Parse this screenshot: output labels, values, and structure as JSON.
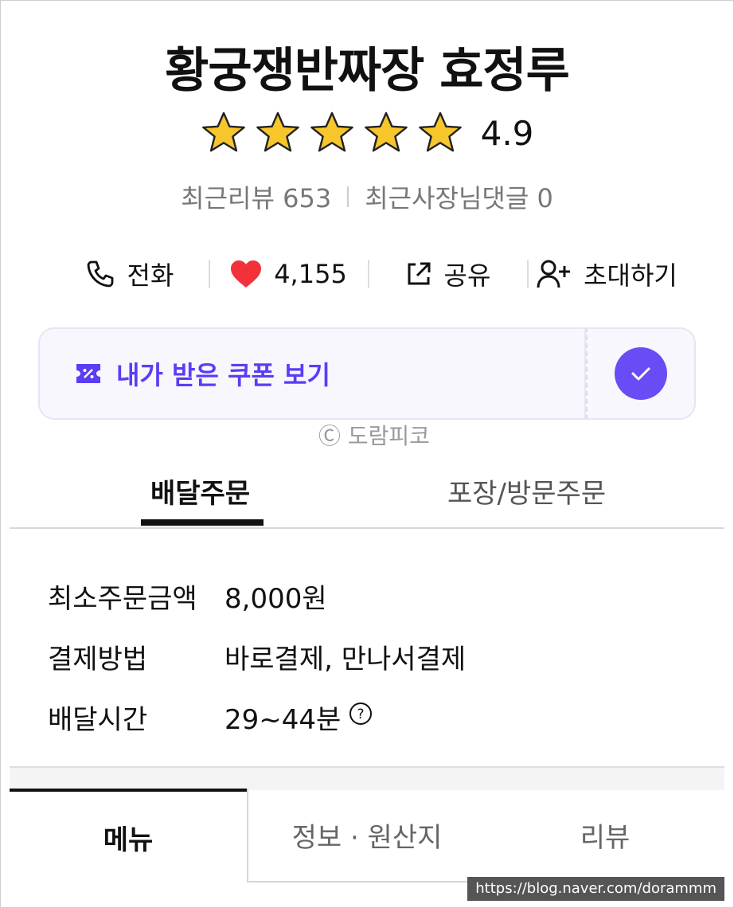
{
  "store": {
    "name": "황궁쟁반짜장 효정루",
    "rating": "4.9",
    "rating_stars": 5,
    "recent_reviews": "최근리뷰 653",
    "owner_replies": "최근사장님댓글 0"
  },
  "actions": {
    "call": "전화",
    "likes": "4,155",
    "share": "공유",
    "invite": "초대하기"
  },
  "coupon": {
    "label": "내가 받은 쿠폰 보기"
  },
  "watermark": "Ⓒ 도람피코",
  "order_tabs": {
    "delivery": "배달주문",
    "pickup": "포장/방문주문"
  },
  "info": {
    "rows": [
      {
        "key": "최소주문금액",
        "value": "8,000원"
      },
      {
        "key": "결제방법",
        "value": "바로결제, 만나서결제"
      },
      {
        "key": "배달시간",
        "value": "29~44분"
      }
    ]
  },
  "bottom_tabs": {
    "menu": "메뉴",
    "info": "정보 · 원산지",
    "review": "리뷰"
  },
  "url_badge": "https://blog.naver.com/dorammm",
  "colors": {
    "accent": "#6a4cf6",
    "coupon_text": "#5b3df5",
    "heart": "#f2313b",
    "star": "#f7c62b"
  }
}
